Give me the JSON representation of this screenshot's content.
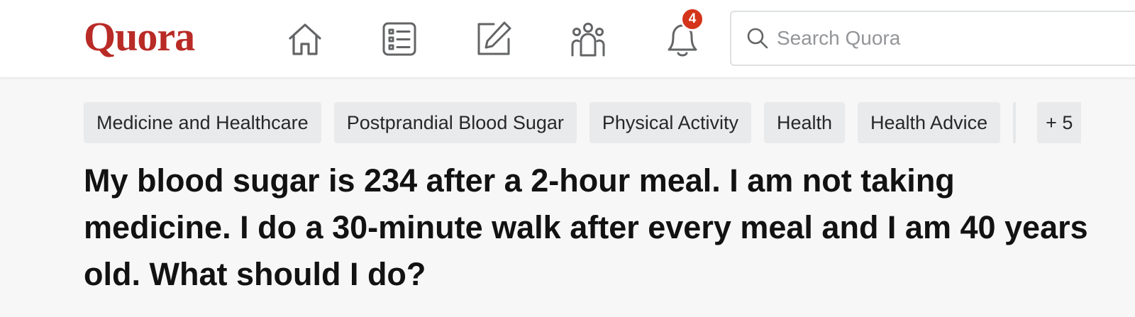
{
  "header": {
    "logo_text": "Quora",
    "brand_color": "#b92b27",
    "nav": [
      {
        "icon": "home-icon"
      },
      {
        "icon": "following-list-icon"
      },
      {
        "icon": "answer-pencil-icon"
      },
      {
        "icon": "spaces-icon"
      },
      {
        "icon": "notifications-bell-icon",
        "badge": "4"
      }
    ],
    "search": {
      "placeholder": "Search Quora",
      "icon": "search-icon"
    }
  },
  "topics": [
    "Medicine and Healthcare",
    "Postprandial Blood Sugar",
    "Physical Activity",
    "Health",
    "Health Advice"
  ],
  "more_topics": "+ 5",
  "question": {
    "title": "My blood sugar is 234 after a 2-hour meal. I am not taking medicine. I do a 30-minute walk after every meal and I am 40 years old. What should I do?"
  }
}
